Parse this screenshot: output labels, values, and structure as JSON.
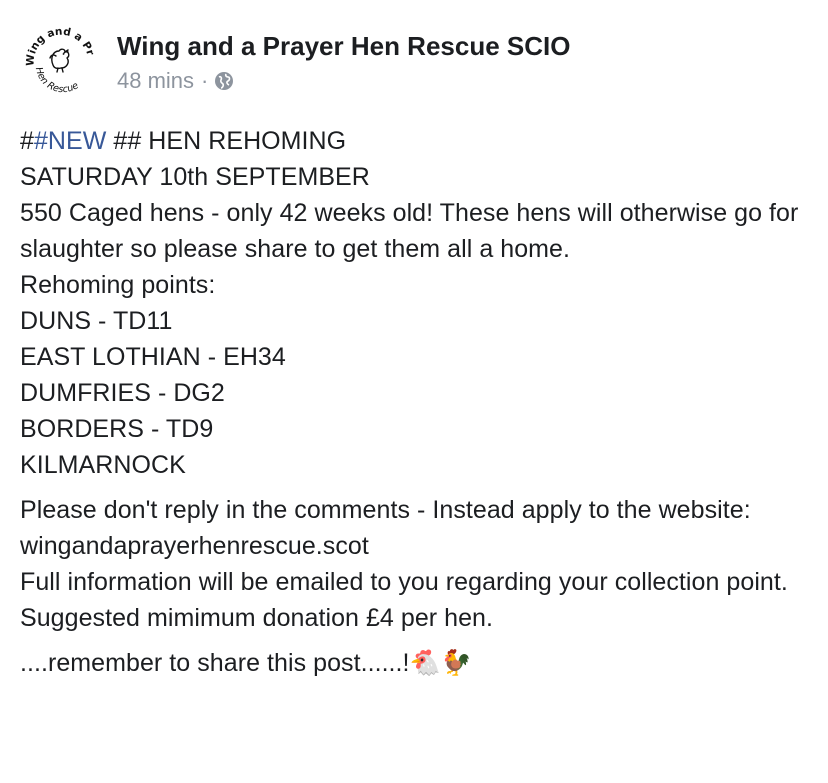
{
  "post": {
    "page_name": "Wing and a Prayer Hen Rescue SCIO",
    "timestamp": "48 mins",
    "separator": "·",
    "privacy_icon": "globe-icon",
    "avatar": {
      "logo_text_top": "Wing and a Prayer",
      "logo_text_bottom": "Hen Rescue",
      "icon": "hen-logo-icon"
    },
    "body": {
      "hashtag_prefix": "#",
      "hashtag": "#NEW",
      "headline_rest": " ## HEN REHOMING",
      "date_line": "SATURDAY 10th SEPTEMBER",
      "description": "550 Caged hens - only 42 weeks old! These hens will otherwise go for slaughter so please share to get them all a home.",
      "points_heading": "Rehoming points:",
      "points": [
        "DUNS - TD11",
        "EAST LOTHIAN - EH34",
        "DUMFRIES - DG2",
        "BORDERS - TD9",
        "KILMARNOCK"
      ],
      "apply_text": "Please don't reply in the comments - Instead apply to the website: wingandaprayerhenrescue.scot",
      "info_text": "Full information will be emailed to you regarding your collection point.",
      "donation_text": "Suggested mimimum donation £4 per hen.",
      "share_reminder": "....remember to share this post......!",
      "emojis": "🐔🐓"
    }
  }
}
